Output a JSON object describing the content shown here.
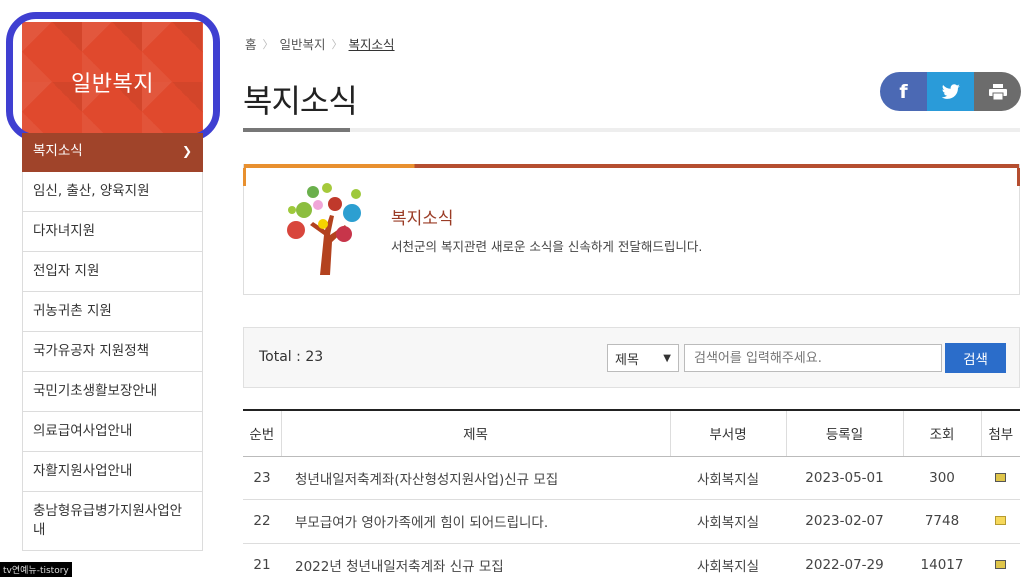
{
  "sidebar": {
    "title": "일반복지",
    "items": [
      {
        "label": "복지소식",
        "active": true
      },
      {
        "label": "임신, 출산, 양육지원"
      },
      {
        "label": "다자녀지원"
      },
      {
        "label": "전입자 지원"
      },
      {
        "label": "귀농귀촌 지원"
      },
      {
        "label": "국가유공자 지원정책"
      },
      {
        "label": "국민기초생활보장안내"
      },
      {
        "label": "의료급여사업안내"
      },
      {
        "label": "자활지원사업안내"
      },
      {
        "label": "충남형유급병가지원사업안내"
      }
    ]
  },
  "breadcrumb": [
    "홈",
    "일반복지",
    "복지소식"
  ],
  "page_title": "복지소식",
  "share": {
    "facebook": "f",
    "twitter": "twitter-bird",
    "print": "printer"
  },
  "intro": {
    "title": "복지소식",
    "description": "서천군의 복지관련 새로운 소식을 신속하게 전달해드립니다."
  },
  "search": {
    "total": "Total : 23",
    "select_value": "제목",
    "placeholder": "검색어를 입력해주세요.",
    "button": "검색"
  },
  "table": {
    "headers": [
      "순번",
      "제목",
      "부서명",
      "등록일",
      "조회",
      "첨부"
    ],
    "rows": [
      {
        "no": "23",
        "title": "청년내일저축계좌(자산형성지원사업)신규 모집",
        "dept": "사회복지실",
        "date": "2023-05-01",
        "views": "300",
        "attach": "hwp-file-icon"
      },
      {
        "no": "22",
        "title": "부모급여가 영아가족에게 힘이 되어드립니다.",
        "dept": "사회복지실",
        "date": "2023-02-07",
        "views": "7748",
        "attach": "image-file-icon"
      },
      {
        "no": "21",
        "title": "2022년 청년내일저축계좌 신규 모집",
        "dept": "사회복지실",
        "date": "2022-07-29",
        "views": "14017",
        "attach": "hwp-file-icon"
      }
    ]
  },
  "watermark": "tv연예뉴-tistory"
}
